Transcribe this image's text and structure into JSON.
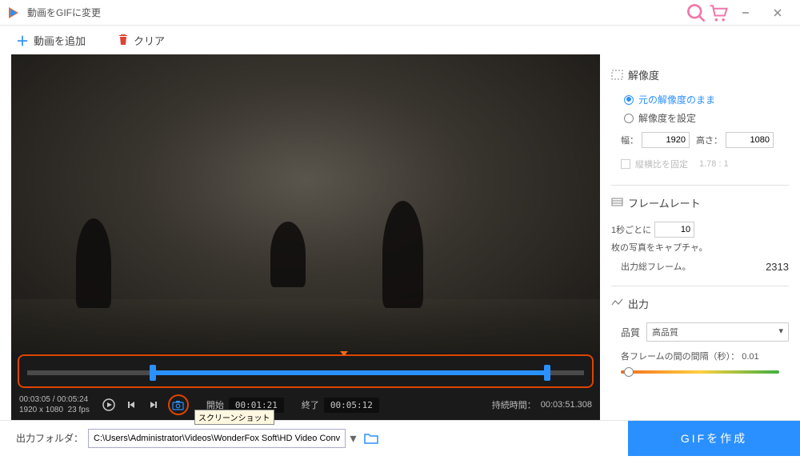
{
  "titlebar": {
    "title": "動画をGIFに変更"
  },
  "toolbar": {
    "add": "動画を追加",
    "clear": "クリア"
  },
  "player": {
    "current": "00:03:05",
    "total": "00:05:24",
    "resolution": "1920 x 1080",
    "fps": "23 fps",
    "start_label": "開始",
    "start_time": "00:01:21",
    "end_label": "終了",
    "end_time": "00:05:12",
    "dur_label": "持続時間：",
    "dur_time": "00:03:51.308"
  },
  "tooltip": "スクリーンショット",
  "side": {
    "res_head": "解像度",
    "radio1": "元の解像度のまま",
    "radio2": "解像度を設定",
    "width_label": "幅：",
    "width": "1920",
    "height_label": "高さ：",
    "height": "1080",
    "lock": "縦横比を固定",
    "ratio": "1.78 : 1",
    "fr_head": "フレームレート",
    "fr_pre": "1秒ごとに",
    "fr_val": "10",
    "fr_post": "枚の写真をキャプチャ。",
    "total_frames_label": "出力総フレーム。",
    "total_frames": "2313",
    "out_head": "出力",
    "quality_label": "品質",
    "quality_val": "高品質",
    "gap_label": "各フレームの間の間隔（秒）：",
    "gap_val": "0.01"
  },
  "footer": {
    "label": "出力フォルダ：",
    "path": "C:\\Users\\Administrator\\Videos\\WonderFox Soft\\HD Video Converter Factory Pro\\SaveImage\\",
    "create": "GIFを作成"
  }
}
